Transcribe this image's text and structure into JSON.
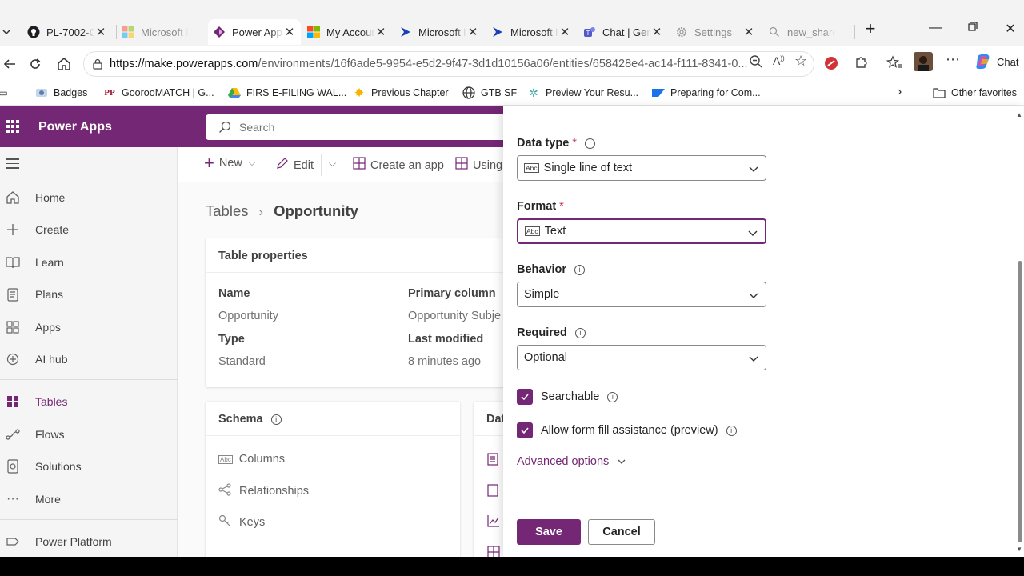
{
  "browser": {
    "tabs": [
      {
        "title": "PL-7002-C",
        "icon": "github-icon",
        "active": false
      },
      {
        "title": "Microsoft l",
        "icon": "microsoft-icon",
        "active": false
      },
      {
        "title": "Power App",
        "icon": "power-apps-icon",
        "active": true
      },
      {
        "title": "My Accour",
        "icon": "microsoft-icon",
        "active": false
      },
      {
        "title": "Microsoft l",
        "icon": "dynamics-icon",
        "active": false
      },
      {
        "title": "Microsoft l",
        "icon": "dynamics-icon",
        "active": false
      },
      {
        "title": "Chat | Gen",
        "icon": "teams-icon",
        "active": false
      },
      {
        "title": "Settings",
        "icon": "gear-icon",
        "active": false
      },
      {
        "title": "new_share",
        "icon": "search-icon",
        "active": false
      }
    ],
    "url_domain": "https://make.powerapps.com",
    "url_path": "/environments/16f6ade5-9954-e5d2-9f47-3d1d10156a06/entities/658428e4-ac14-f111-8341-0...",
    "chat_label": "Chat",
    "bookmarks": [
      {
        "label": "Badges",
        "icon": "badge-icon"
      },
      {
        "label": "GoorooMATCH | G...",
        "icon": "pp-icon"
      },
      {
        "label": "FIRS E-FILING WAL...",
        "icon": "drive-icon"
      },
      {
        "label": "Previous Chapter",
        "icon": "star-icon"
      },
      {
        "label": "GTB SF",
        "icon": "globe-icon"
      },
      {
        "label": "Preview Your Resu...",
        "icon": "gear-icon"
      },
      {
        "label": "Preparing for Com...",
        "icon": "sap-icon"
      }
    ],
    "other_favorites": "Other favorites"
  },
  "app": {
    "title": "Power Apps",
    "search_placeholder": "Search"
  },
  "nav": {
    "items": [
      {
        "label": "Home",
        "icon": "home-icon"
      },
      {
        "label": "Create",
        "icon": "plus-icon"
      },
      {
        "label": "Learn",
        "icon": "book-icon"
      },
      {
        "label": "Plans",
        "icon": "plans-icon"
      },
      {
        "label": "Apps",
        "icon": "apps-icon"
      },
      {
        "label": "AI hub",
        "icon": "ai-hub-icon"
      },
      {
        "label": "Tables",
        "icon": "table-icon",
        "selected": true
      },
      {
        "label": "Flows",
        "icon": "flow-icon"
      },
      {
        "label": "Solutions",
        "icon": "solutions-icon"
      },
      {
        "label": "More",
        "icon": "more-icon"
      },
      {
        "label": "Power Platform",
        "icon": "power-platform-icon"
      }
    ]
  },
  "commands": {
    "new": "New",
    "edit": "Edit",
    "create_app": "Create an app",
    "using": "Using"
  },
  "breadcrumb": {
    "parent": "Tables",
    "current": "Opportunity"
  },
  "table_properties": {
    "title": "Table properties",
    "name_label": "Name",
    "name_value": "Opportunity",
    "primary_label": "Primary column",
    "primary_value": "Opportunity Subje",
    "type_label": "Type",
    "type_value": "Standard",
    "modified_label": "Last modified",
    "modified_value": "8 minutes ago"
  },
  "schema": {
    "title": "Schema",
    "items": [
      "Columns",
      "Relationships",
      "Keys"
    ]
  },
  "data_card_title": "Dat",
  "panel": {
    "data_type_label": "Data type",
    "data_type_value": "Single line of text",
    "format_label": "Format",
    "format_value": "Text",
    "behavior_label": "Behavior",
    "behavior_value": "Simple",
    "required_label": "Required",
    "required_value": "Optional",
    "searchable_label": "Searchable",
    "searchable_checked": true,
    "form_fill_label": "Allow form fill assistance (preview)",
    "form_fill_checked": true,
    "advanced_label": "Advanced options",
    "save_label": "Save",
    "cancel_label": "Cancel"
  },
  "colors": {
    "brand": "#742774",
    "required": "#c4314b"
  }
}
